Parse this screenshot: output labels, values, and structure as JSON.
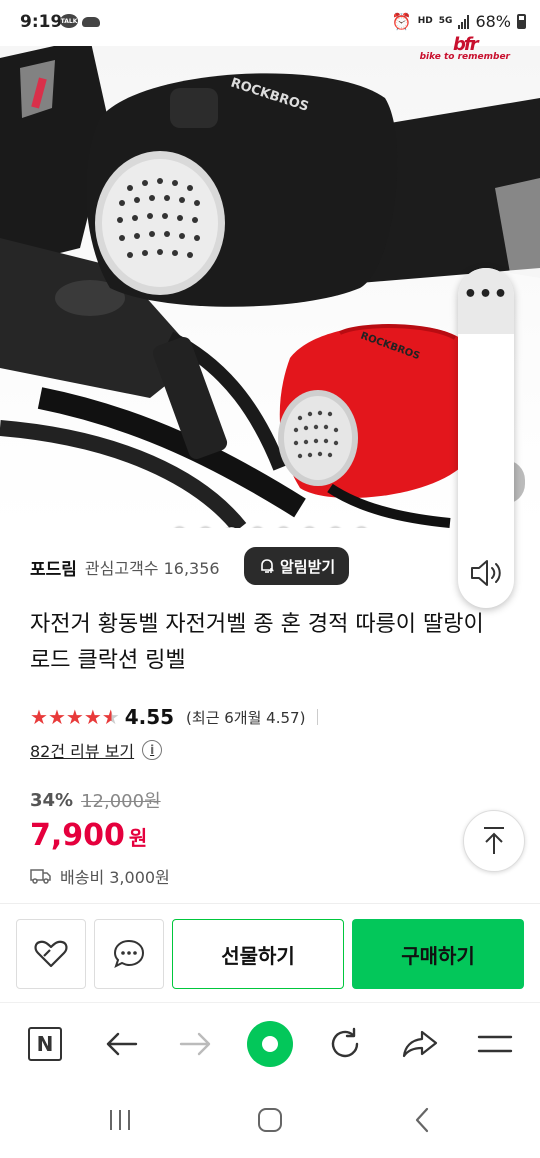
{
  "status_bar": {
    "time": "9:19",
    "talk_badge": "TALK",
    "hd_label": "HD",
    "network": "5G",
    "battery": "68%"
  },
  "watermark": {
    "mark": "bfr",
    "tagline": "bike to remember"
  },
  "carousel": {
    "slide_count": 8,
    "active_index": 6
  },
  "side_panel": {
    "more_label": "•••"
  },
  "store": {
    "name": "포드림",
    "followers": "관심고객수 16,356",
    "alarm_button": "알림받기"
  },
  "product": {
    "title": "자전거 황동벨 자전거벨 종 혼 경적 따릉이 딸랑이 로드 클락션 링벨",
    "rating": "4.55",
    "rating_stars": 4.55,
    "recent_rating": "(최근 6개월 4.57)",
    "review_link": "82건 리뷰 보기",
    "info_icon": "i",
    "discount": "34%",
    "original_price": "12,000원",
    "price": "7,900",
    "currency": "원",
    "shipping": "배송비 3,000원"
  },
  "actions": {
    "gift_button": "선물하기",
    "buy_button": "구매하기"
  },
  "browser_toolbar": {
    "n_label": "N",
    "icons": [
      "naver-n-icon",
      "back-arrow-icon",
      "forward-arrow-icon",
      "home-icon",
      "refresh-icon",
      "share-icon",
      "menu-icon"
    ]
  },
  "colors": {
    "brand_green": "#03c75a",
    "price_red": "#e5003d",
    "star_red": "#e83a3a"
  }
}
